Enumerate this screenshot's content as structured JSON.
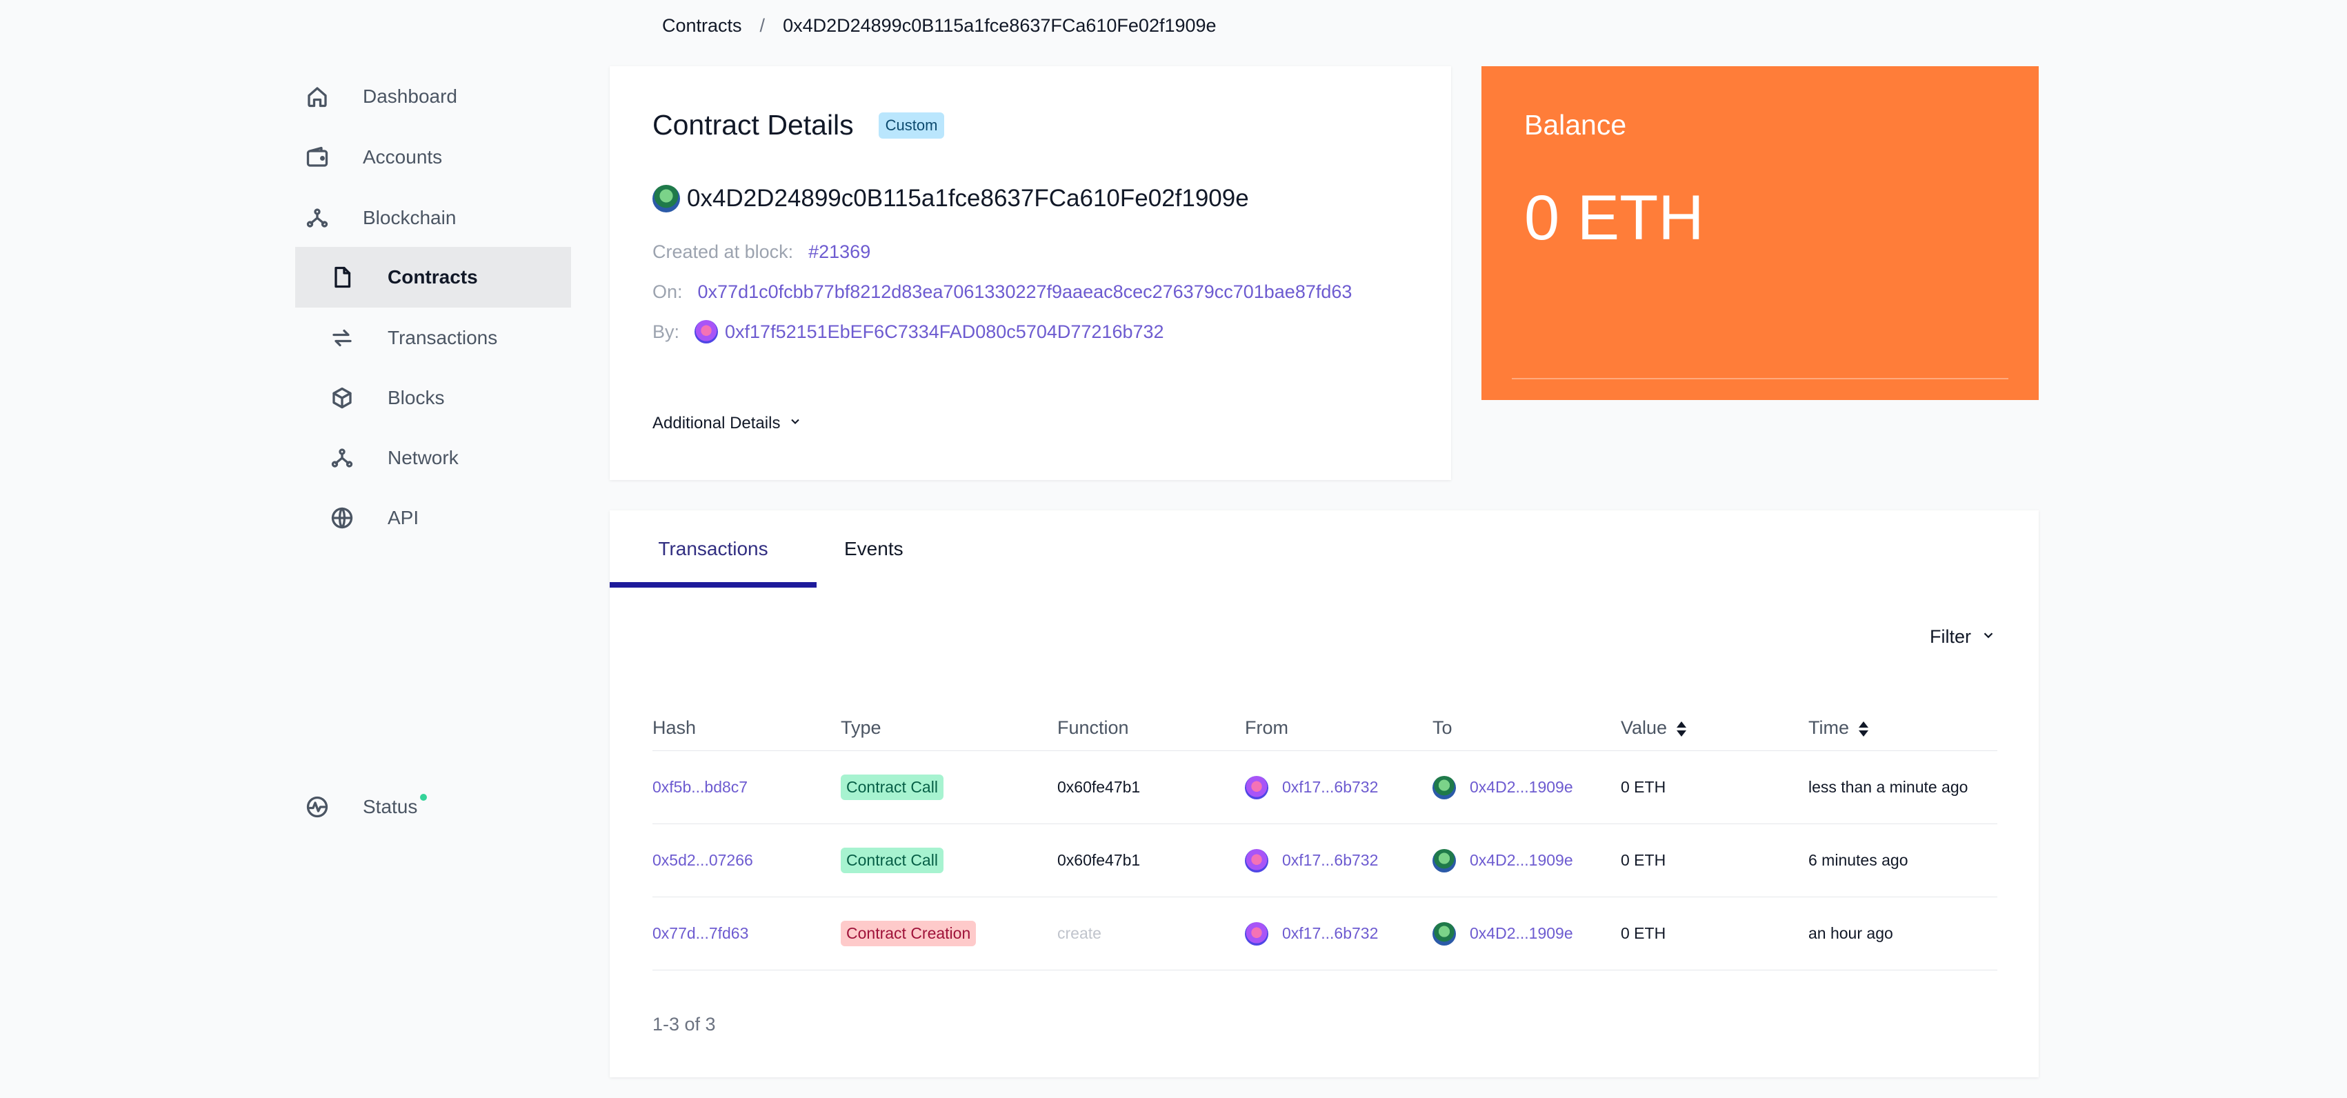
{
  "breadcrumb": {
    "parent": "Contracts",
    "separator": "/",
    "current": "0x4D2D24899c0B115a1fce8637FCa610Fe02f1909e"
  },
  "sidebar": {
    "items": [
      {
        "label": "Dashboard",
        "icon": "home-icon"
      },
      {
        "label": "Accounts",
        "icon": "wallet-icon"
      },
      {
        "label": "Blockchain",
        "icon": "network-icon"
      },
      {
        "label": "Contracts",
        "icon": "document-icon",
        "active": true
      },
      {
        "label": "Transactions",
        "icon": "arrows-exchange-icon"
      },
      {
        "label": "Blocks",
        "icon": "cube-icon"
      },
      {
        "label": "Network",
        "icon": "network-icon"
      },
      {
        "label": "API",
        "icon": "globe-icon"
      }
    ],
    "status": {
      "label": "Status",
      "icon": "pulse-icon",
      "dot_color": "#34d399"
    }
  },
  "details": {
    "title": "Contract Details",
    "badge": "Custom",
    "address": "0x4D2D24899c0B115a1fce8637FCa610Fe02f1909e",
    "created_label": "Created at block:",
    "created_value": "#21369",
    "on_label": "On:",
    "on_value": "0x77d1c0fcbb77bf8212d83ea7061330227f9aaeac8cec276379cc701bae87fd63",
    "by_label": "By:",
    "by_value": "0xf17f52151EbEF6C7334FAD080c5704D77216b732",
    "additional": "Additional Details"
  },
  "balance": {
    "label": "Balance",
    "value": "0 ETH",
    "color": "#ff7d39"
  },
  "tabs": [
    {
      "label": "Transactions",
      "active": true
    },
    {
      "label": "Events"
    }
  ],
  "filter_label": "Filter",
  "table": {
    "headers": [
      "Hash",
      "Type",
      "Function",
      "From",
      "To",
      "Value",
      "Time"
    ],
    "rows": [
      {
        "hash": "0xf5b...bd8c7",
        "type": "Contract Call",
        "function": "0x60fe47b1",
        "from": "0xf17...6b732",
        "to": "0x4D2...1909e",
        "value": "0 ETH",
        "time": "less than a minute ago"
      },
      {
        "hash": "0x5d2...07266",
        "type": "Contract Call",
        "function": "0x60fe47b1",
        "from": "0xf17...6b732",
        "to": "0x4D2...1909e",
        "value": "0 ETH",
        "time": "6 minutes ago"
      },
      {
        "hash": "0x77d...7fd63",
        "type": "Contract Creation",
        "function": "create",
        "from": "0xf17...6b732",
        "to": "0x4D2...1909e",
        "value": "0 ETH",
        "time": "an hour ago"
      }
    ],
    "pagination": "1-3 of 3"
  },
  "colors": {
    "accent": "#6d5bd0",
    "tab_active": "#1e1b9b",
    "call_pill": "#a7f3d0",
    "create_pill": "#fecaca"
  }
}
